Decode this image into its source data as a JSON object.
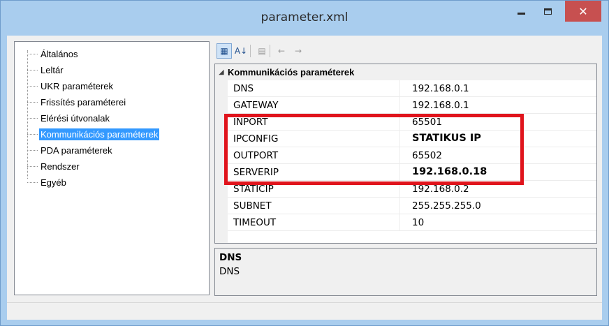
{
  "window": {
    "title": "parameter.xml",
    "close_glyph": "✕"
  },
  "tree": {
    "items": [
      {
        "label": "Általános",
        "selected": false
      },
      {
        "label": "Leltár",
        "selected": false
      },
      {
        "label": "UKR paraméterek",
        "selected": false
      },
      {
        "label": "Frissítés paraméterei",
        "selected": false
      },
      {
        "label": "Elérési útvonalak",
        "selected": false
      },
      {
        "label": "Kommunikációs paraméterek",
        "selected": true
      },
      {
        "label": "PDA paraméterek",
        "selected": false
      },
      {
        "label": "Rendszer",
        "selected": false
      },
      {
        "label": "Egyéb",
        "selected": false
      }
    ]
  },
  "toolbar": {
    "buttons": [
      {
        "icon": "categorized-icon",
        "glyph": "▦",
        "enabled": true
      },
      {
        "icon": "alphabetical-sort-icon",
        "glyph": "A↓",
        "enabled": true
      },
      {
        "icon": "property-pages-icon",
        "glyph": "▤",
        "enabled": false
      },
      {
        "icon": "back-arrow-icon",
        "glyph": "←",
        "enabled": false
      },
      {
        "icon": "forward-arrow-icon",
        "glyph": "→",
        "enabled": false
      }
    ]
  },
  "grid": {
    "category": {
      "label": "Kommunikációs paraméterek",
      "expander": "◢"
    },
    "properties": [
      {
        "name": "DNS",
        "value": "192.168.0.1",
        "bold": false
      },
      {
        "name": "GATEWAY",
        "value": "192.168.0.1",
        "bold": false
      },
      {
        "name": "INPORT",
        "value": "65501",
        "bold": false
      },
      {
        "name": "IPCONFIG",
        "value": "STATIKUS IP",
        "bold": true
      },
      {
        "name": "OUTPORT",
        "value": "65502",
        "bold": false
      },
      {
        "name": "SERVERIP",
        "value": "192.168.0.18",
        "bold": true
      },
      {
        "name": "STATICIP",
        "value": "192.168.0.2",
        "bold": false
      },
      {
        "name": "SUBNET",
        "value": "255.255.255.0",
        "bold": false
      },
      {
        "name": "TIMEOUT",
        "value": "10",
        "bold": false
      }
    ]
  },
  "description": {
    "title": "DNS",
    "text": "DNS"
  },
  "colors": {
    "highlight_box": "#e0141c",
    "selection": "#3399ff",
    "titlebar": "#a9cdee",
    "close_button": "#c75050"
  }
}
